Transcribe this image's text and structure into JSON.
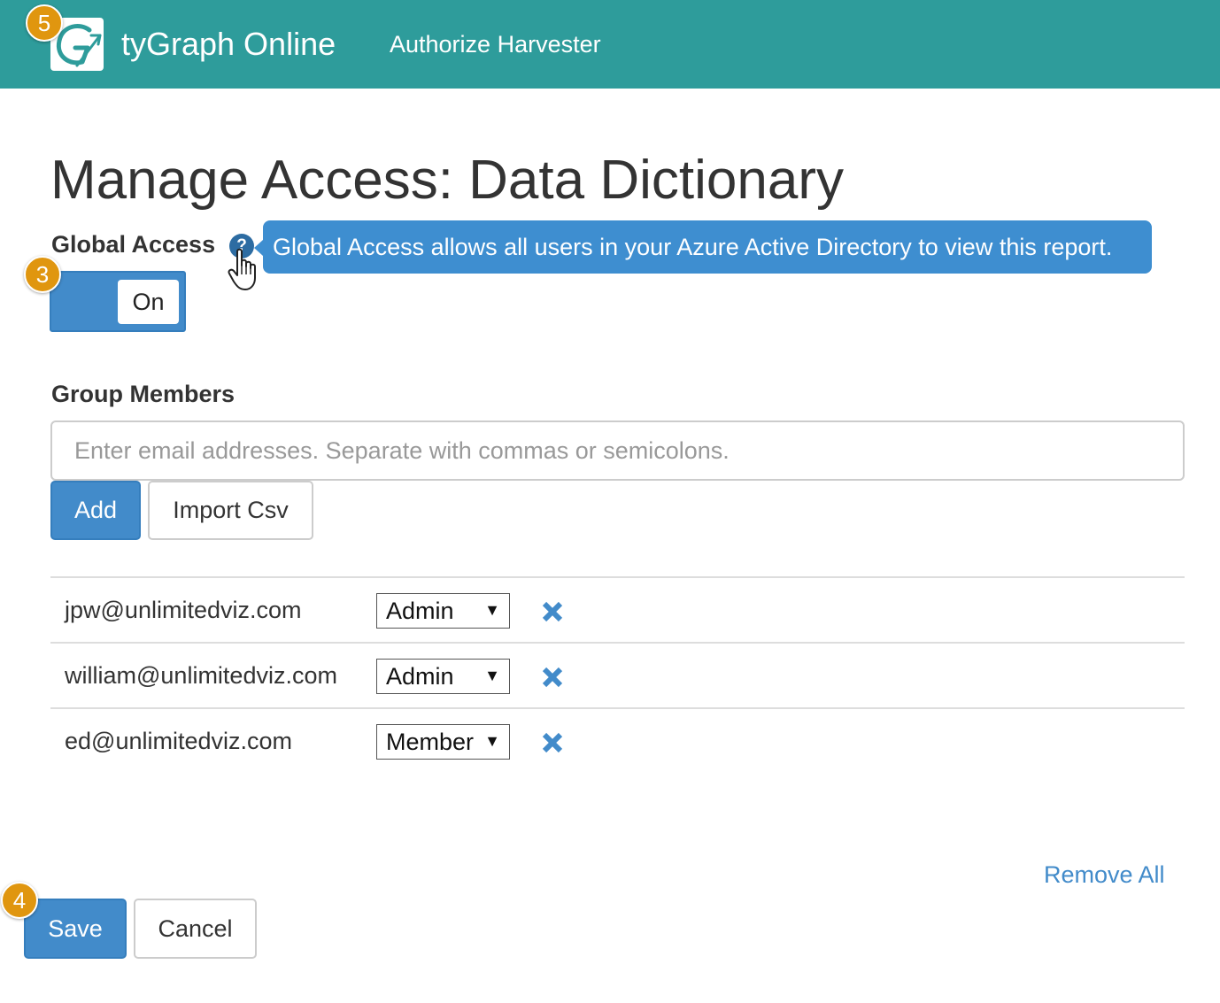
{
  "navbar": {
    "logo_icon": "tygraph-logo-icon",
    "brand": "tyGraph Online",
    "link": "Authorize Harvester"
  },
  "badges": {
    "logo": "5",
    "toggle": "3",
    "save": "4"
  },
  "page": {
    "title": "Manage Access: Data Dictionary"
  },
  "global_access": {
    "label": "Global Access",
    "help_icon": "question-circle-icon",
    "help_glyph": "?",
    "tooltip": "Global Access allows all users in your Azure Active Directory to view this report.",
    "toggle_label": "On",
    "toggle_state": true
  },
  "group_members": {
    "label": "Group Members",
    "input_value": "",
    "input_placeholder": "Enter email addresses. Separate with commas or semicolons.",
    "add_label": "Add",
    "import_label": "Import Csv",
    "members": [
      {
        "email": "jpw@unlimitedviz.com",
        "role": "Admin"
      },
      {
        "email": "william@unlimitedviz.com",
        "role": "Admin"
      },
      {
        "email": "ed@unlimitedviz.com",
        "role": "Member"
      }
    ],
    "remove_icon": "close-x-icon",
    "dropdown_arrow": "▼",
    "remove_all_label": "Remove All"
  },
  "footer": {
    "save_label": "Save",
    "cancel_label": "Cancel"
  },
  "colors": {
    "navbar": "#2e9c9b",
    "primary": "#428bca",
    "tooltip": "#3e8ed0",
    "badge": "#e0960f",
    "remove_icon": "#428bca"
  }
}
